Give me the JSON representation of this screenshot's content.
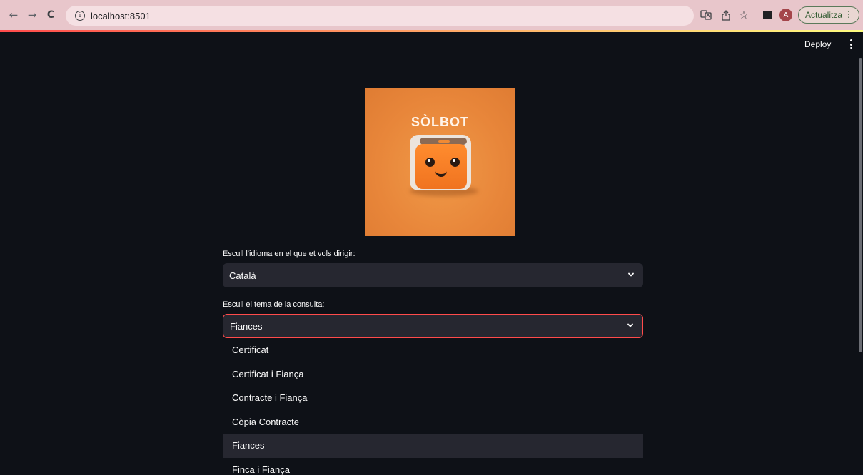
{
  "browser": {
    "url": "localhost:8501",
    "profile_initial": "A",
    "update_label": "Actualitza",
    "icons": [
      "back-arrow-icon",
      "forward-arrow-icon",
      "reload-icon",
      "info-icon",
      "translate-icon",
      "share-icon",
      "bookmark-star-icon",
      "side-panel-icon",
      "kebab-menu-icon"
    ]
  },
  "app": {
    "deploy_label": "Deploy",
    "logo_text": "SÒLBOT",
    "language": {
      "label": "Escull l'idioma en el que et vols dirigir:",
      "value": "Català"
    },
    "topic": {
      "label": "Escull el tema de la consulta:",
      "value": "Fiances",
      "options": [
        "Certificat",
        "Certificat i Fiança",
        "Contracte i Fiança",
        "Còpia Contracte",
        "Fiances",
        "Finca i Fiança"
      ],
      "selected_index": 4
    },
    "colors": {
      "background": "#0e1117",
      "widget": "#262730",
      "accent": "#ff4b4b",
      "logo_orange": "#e8863a"
    }
  }
}
